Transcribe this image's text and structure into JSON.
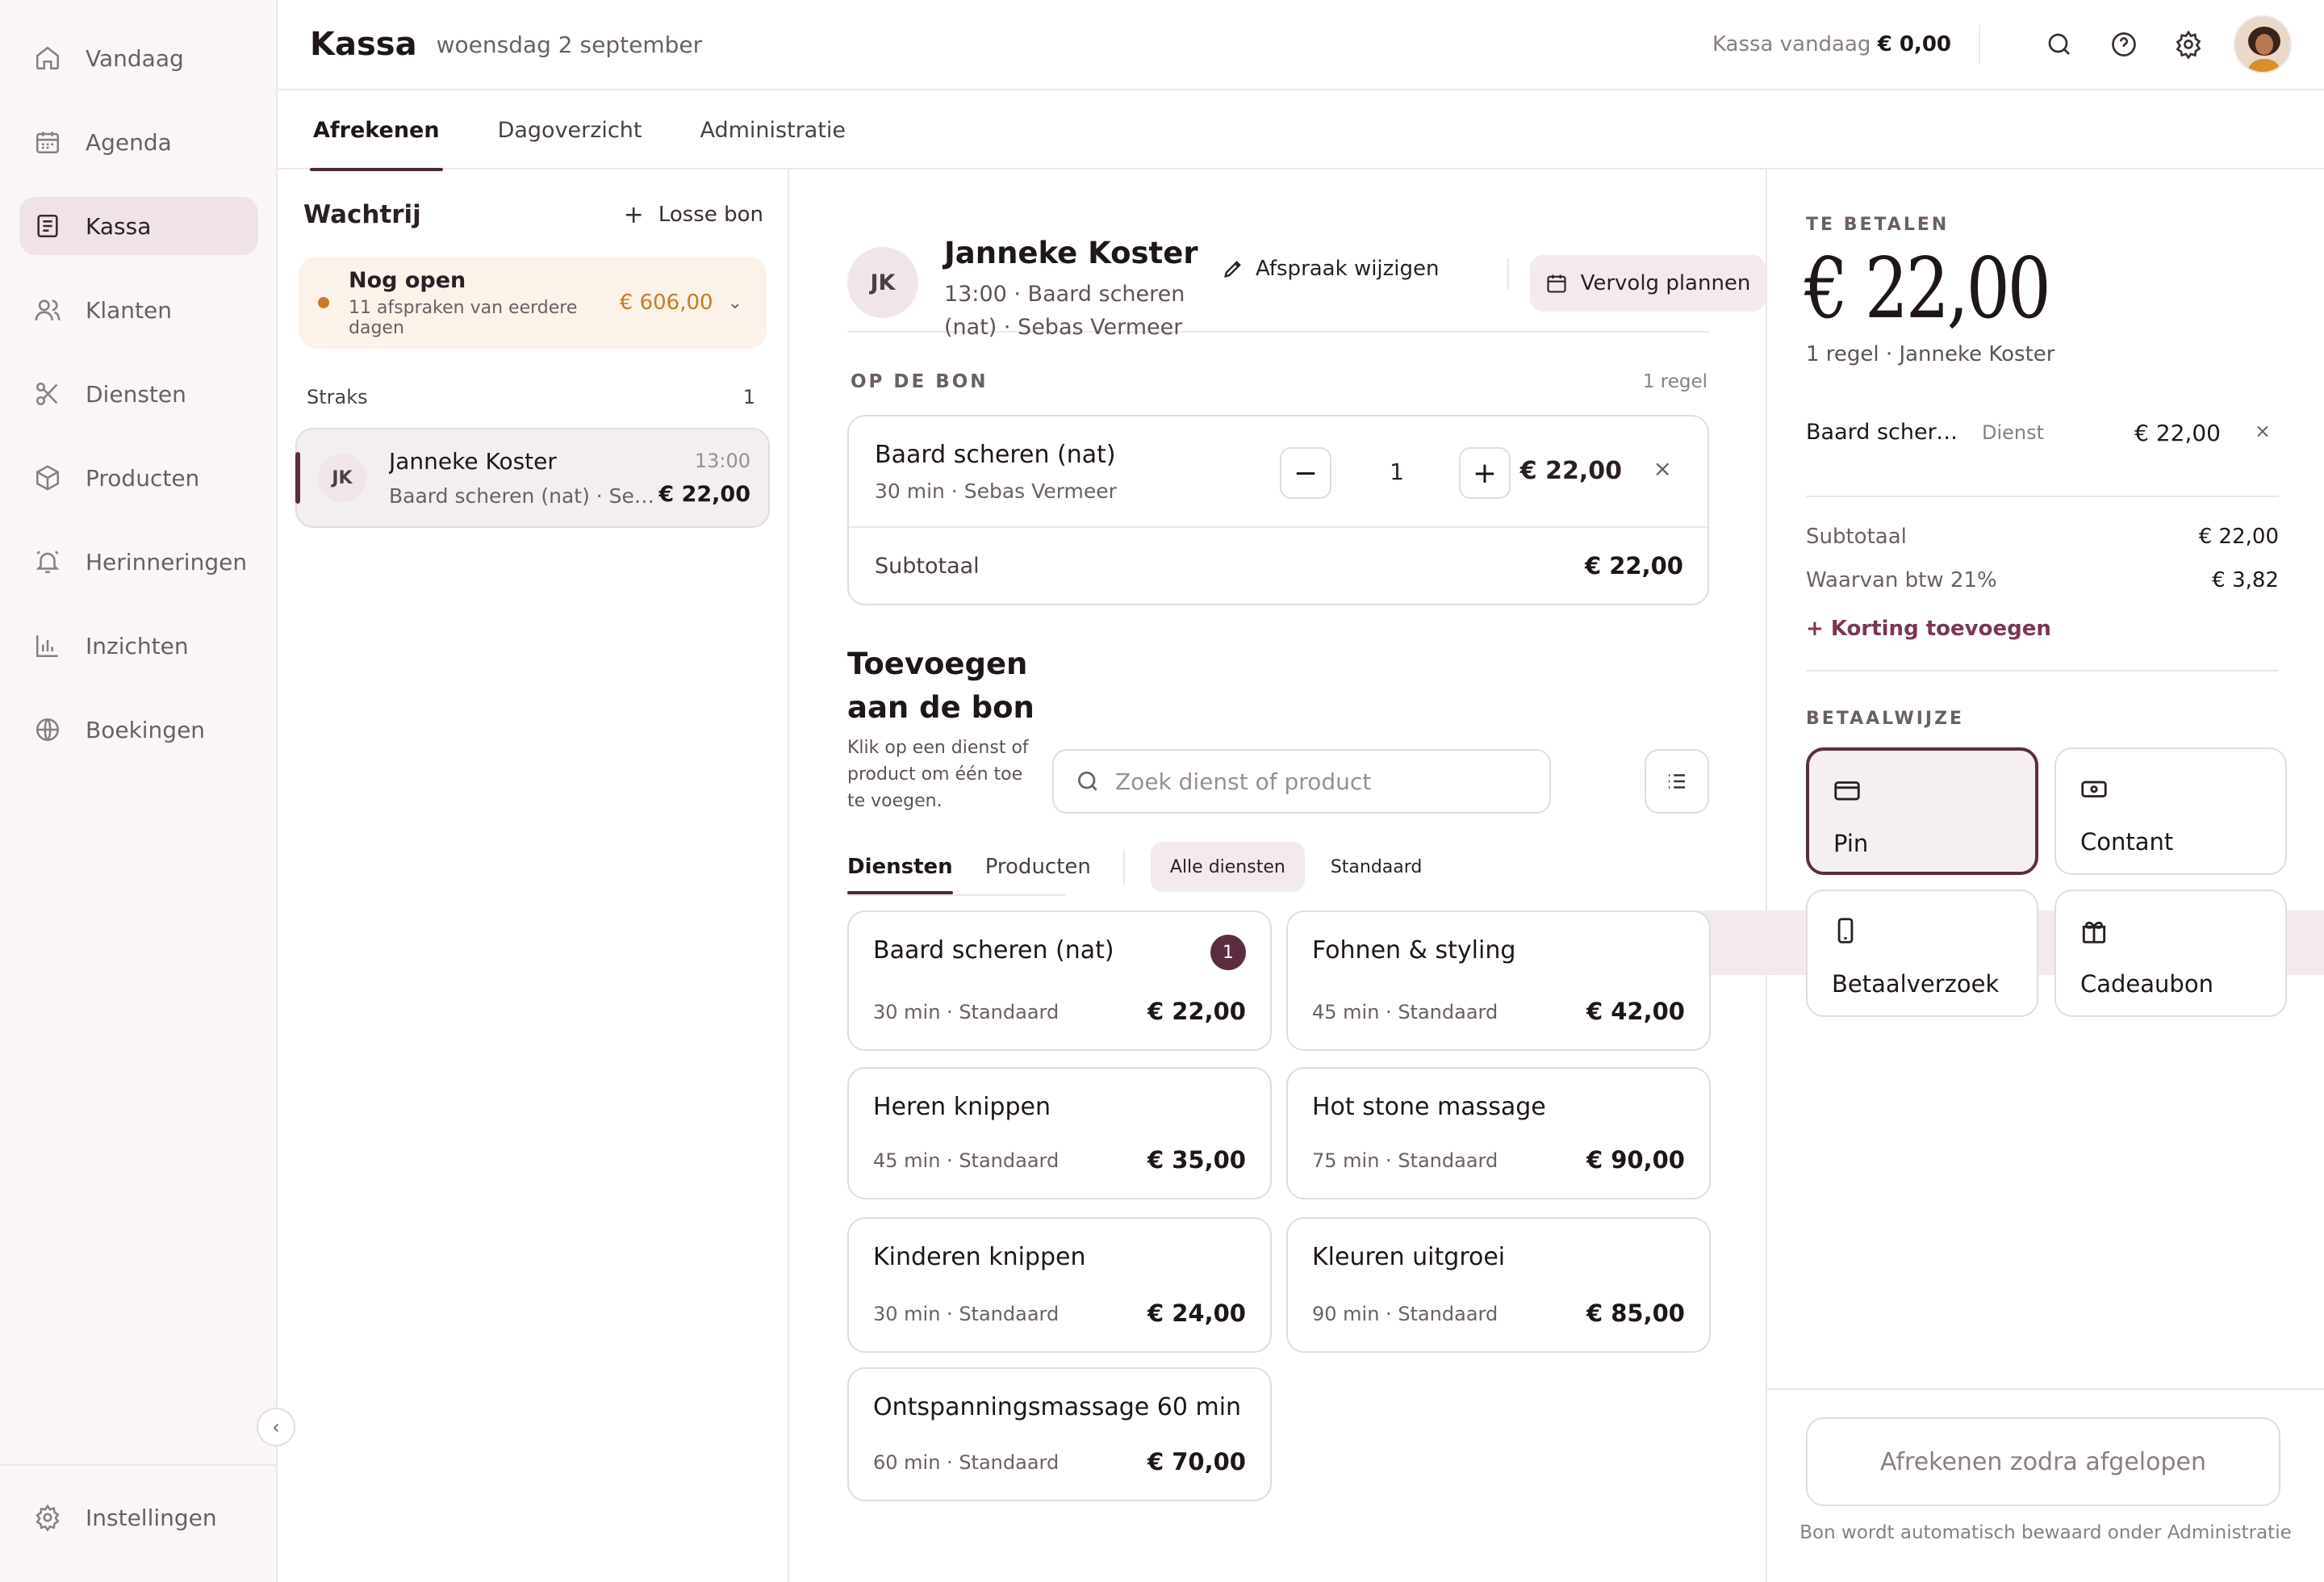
{
  "sidebar": {
    "items": [
      {
        "label": "Vandaag",
        "icon": "home-icon"
      },
      {
        "label": "Agenda",
        "icon": "calendar-icon"
      },
      {
        "label": "Kassa",
        "icon": "receipt-icon",
        "active": true
      },
      {
        "label": "Klanten",
        "icon": "users-icon"
      },
      {
        "label": "Diensten",
        "icon": "scissors-icon"
      },
      {
        "label": "Producten",
        "icon": "box-icon"
      },
      {
        "label": "Herinneringen",
        "icon": "bell-icon"
      },
      {
        "label": "Inzichten",
        "icon": "bar-chart-icon"
      },
      {
        "label": "Boekingen",
        "icon": "globe-icon"
      }
    ],
    "settings_label": "Instellingen",
    "collapse_glyph": "‹"
  },
  "header": {
    "title": "Kassa",
    "date": "woensdag 2 september",
    "kassa_today_label": "Kassa vandaag",
    "kassa_today_value": "€ 0,00"
  },
  "tabs": [
    "Afrekenen",
    "Dagoverzicht",
    "Administratie"
  ],
  "queue": {
    "title": "Wachtrij",
    "losse_bon": "Losse bon",
    "open": {
      "title": "Nog open",
      "subtitle": "11 afspraken van eerdere dagen",
      "amount": "€ 606,00"
    },
    "straks_label": "Straks",
    "straks_count": "1",
    "item": {
      "initials": "JK",
      "name": "Janneke Koster",
      "sub": "Baard scheren (nat) · Sebas Vermeer",
      "time": "13:00",
      "price": "€ 22,00"
    }
  },
  "customer": {
    "initials": "JK",
    "name": "Janneke Koster",
    "sub": "13:00 · Baard scheren (nat) · Sebas Vermeer",
    "edit_label": "Afspraak wijzigen",
    "plan_label": "Vervolg plannen"
  },
  "bon": {
    "label": "OP DE BON",
    "count": "1 regel",
    "line": {
      "name": "Baard scheren (nat)",
      "sub": "30 min · Sebas Vermeer",
      "qty": "1",
      "price": "€ 22,00"
    },
    "subtotal_label": "Subtotaal",
    "subtotal_value": "€ 22,00"
  },
  "add": {
    "title": "Toevoegen aan de bon",
    "desc": "Klik op een dienst of product om één toe te voegen.",
    "search_placeholder": "Zoek dienst of product",
    "subtabs": [
      "Diensten",
      "Producten"
    ],
    "chips": [
      "Alle diensten",
      "Standaard"
    ]
  },
  "services": [
    {
      "name": "Baard scheren (nat)",
      "sub": "30 min · Standaard",
      "price": "€ 22,00",
      "badge": "1"
    },
    {
      "name": "Fohnen & styling",
      "sub": "45 min · Standaard",
      "price": "€ 42,00"
    },
    {
      "name": "Heren knippen",
      "sub": "45 min · Standaard",
      "price": "€ 35,00"
    },
    {
      "name": "Hot stone massage",
      "sub": "75 min · Standaard",
      "price": "€ 90,00"
    },
    {
      "name": "Kinderen knippen",
      "sub": "30 min · Standaard",
      "price": "€ 24,00"
    },
    {
      "name": "Kleuren uitgroei",
      "sub": "90 min · Standaard",
      "price": "€ 85,00"
    },
    {
      "name": "Ontspanningsmassage 60 min",
      "sub": "60 min · Standaard",
      "price": "€ 70,00"
    }
  ],
  "payment": {
    "label": "TE BETALEN",
    "total": "€ 22,00",
    "meta": "1 regel · Janneke Koster",
    "line": {
      "name": "Baard scheren (nat)",
      "type": "Dienst",
      "price": "€ 22,00"
    },
    "subtotal_label": "Subtotaal",
    "subtotal_value": "€ 22,00",
    "vat_label": "Waarvan btw 21%",
    "vat_value": "€ 3,82",
    "discount_label": "+ Korting toevoegen",
    "methods_label": "BETAALWIJZE",
    "methods": [
      {
        "label": "Pin",
        "icon": "card-icon",
        "active": true
      },
      {
        "label": "Contant",
        "icon": "cash-icon"
      },
      {
        "label": "Betaalverzoek",
        "icon": "phone-icon"
      },
      {
        "label": "Cadeaubon",
        "icon": "gift-icon"
      }
    ],
    "checkout_label": "Afrekenen zodra afgelopen",
    "note": "Bon wordt automatisch bewaard onder Administratie"
  },
  "colors": {
    "accent": "#5a2e40",
    "open_amount": "#c97a22",
    "sidebar_bg": "#faf6f7",
    "active_nav": "#efe3e8"
  }
}
